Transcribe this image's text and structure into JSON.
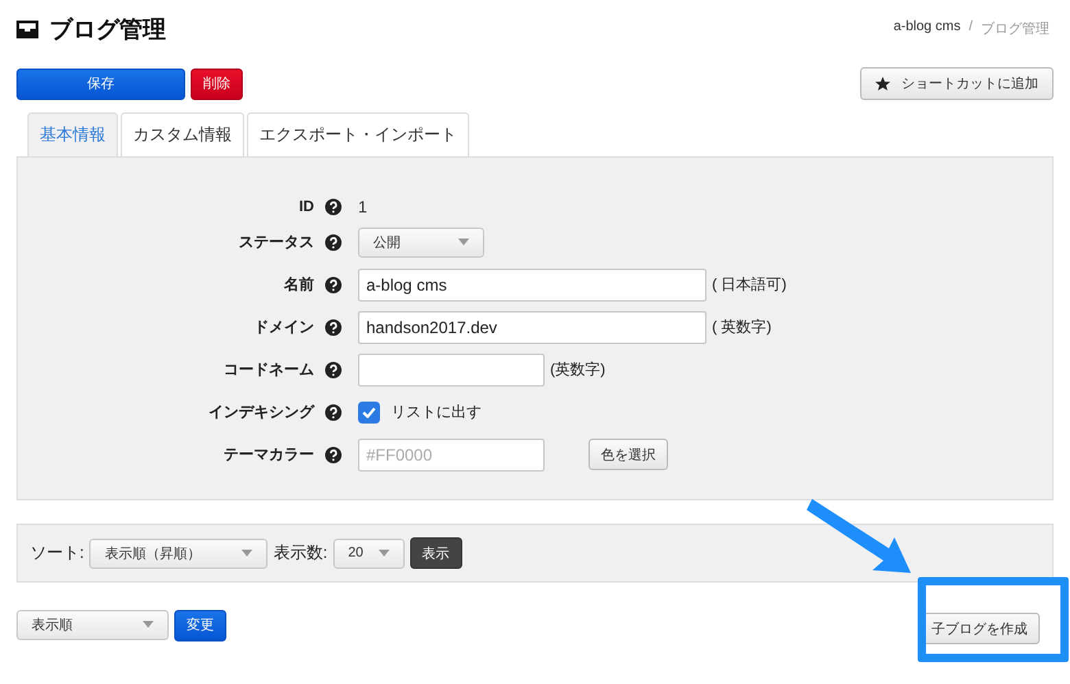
{
  "page": {
    "title": "ブログ管理"
  },
  "breadcrumb": [
    {
      "label": "a-blog cms",
      "kind": "link"
    },
    {
      "separator": "/",
      "label": "ブログ管理",
      "kind": "current"
    }
  ],
  "actions": [
    {
      "label": "保存",
      "kind": "primary"
    },
    {
      "label": "削除",
      "kind": "danger"
    }
  ],
  "shortcut_button": {
    "label": "ショートカットに追加"
  },
  "tabs": [
    {
      "label": "基本情報",
      "selected": true
    },
    {
      "label": "カスタム情報",
      "selected": false
    },
    {
      "label": "エクスポート・インポート",
      "selected": false
    }
  ],
  "fields": [
    {
      "kind": "text",
      "label": "ID",
      "value": "1"
    },
    {
      "kind": "select",
      "label": "ステータス",
      "value": "公開"
    },
    {
      "kind": "input",
      "label": "名前",
      "value": "a-blog cms",
      "note": "( 日本語可)"
    },
    {
      "kind": "input",
      "label": "ドメイン",
      "value": "handson2017.dev",
      "note": "( 英数字)"
    },
    {
      "kind": "short_input",
      "label": "コードネーム",
      "note": "(英数字)"
    },
    {
      "kind": "checkbox",
      "label": "インデキシング",
      "option": "リストに出す",
      "checked": true
    },
    {
      "kind": "color",
      "label": "テーマカラー",
      "placeholder": "#FF0000",
      "button": "色を選択"
    }
  ],
  "sort_bar": {
    "sort_label": "ソート:",
    "sort_value": "表示順（昇順）",
    "count_label": "表示数:",
    "count_value": "20",
    "button": "表示"
  },
  "bulk": {
    "select_value": "表示順",
    "button": "変更"
  },
  "create_child_button": {
    "label": "子ブログを作成"
  }
}
